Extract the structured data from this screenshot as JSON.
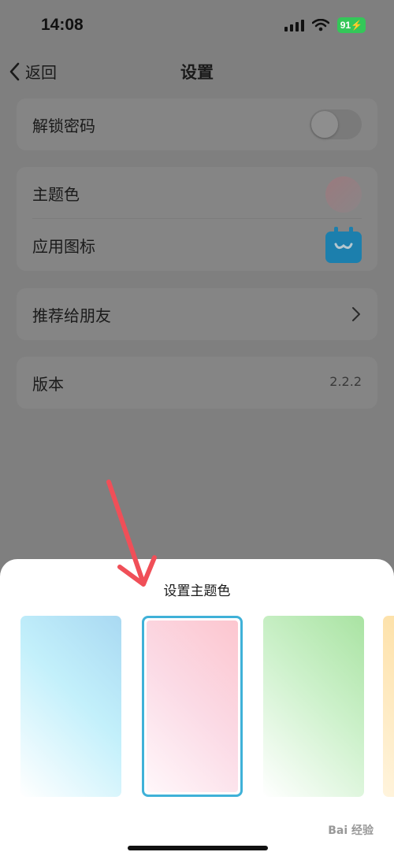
{
  "status_bar": {
    "time": "14:08",
    "battery": "91"
  },
  "nav": {
    "back_label": "返回",
    "title": "设置"
  },
  "settings": {
    "unlock_password": {
      "label": "解锁密码",
      "enabled": false
    },
    "theme_color": {
      "label": "主题色"
    },
    "app_icon": {
      "label": "应用图标"
    },
    "recommend": {
      "label": "推荐给朋友"
    },
    "version": {
      "label": "版本",
      "value": "2.2.2"
    }
  },
  "theme_sheet": {
    "title": "设置主题色",
    "swatches": [
      {
        "name": "blue",
        "selected": false
      },
      {
        "name": "pink",
        "selected": true
      },
      {
        "name": "green",
        "selected": false
      },
      {
        "name": "yellow",
        "selected": false
      }
    ]
  },
  "watermark": "Bai 经验",
  "colors": {
    "accent_border": "#3fb1d8",
    "arrow": "#f04f58",
    "battery": "#34c759",
    "app_icon": "#1c9bd6"
  },
  "icons": [
    "wifi-icon",
    "signal-icon",
    "battery-icon",
    "back-chevron-icon",
    "chevron-right-icon",
    "app-icon",
    "arrow-annotation"
  ]
}
